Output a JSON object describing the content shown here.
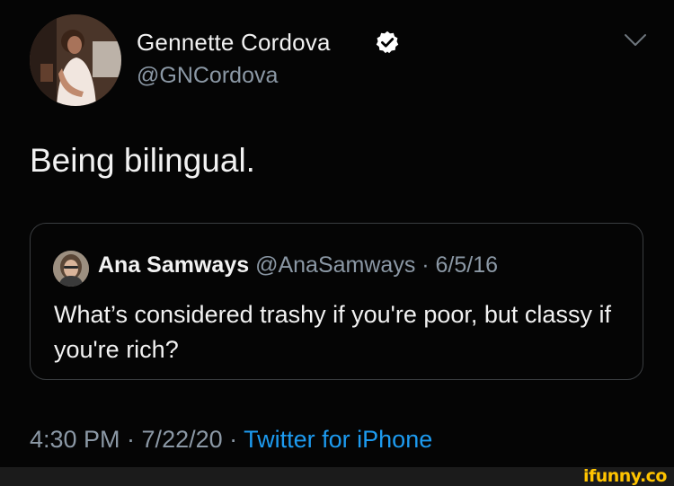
{
  "tweet": {
    "author": {
      "name": "Gennette Cordova",
      "handle": "@GNCordova",
      "verified": true
    },
    "text": "Being bilingual.",
    "quoted": {
      "name": "Ana Samways",
      "meta": "@AnaSamways · 6/5/16",
      "text": "What’s considered trashy if you're poor, but classy if you're rich?"
    },
    "footer": {
      "time_date": "4:30 PM · 7/22/20 · ",
      "source": "Twitter for iPhone"
    }
  },
  "watermark": {
    "text": "ifunny.co"
  },
  "colors": {
    "background": "#000000",
    "text_primary": "#f2f2f2",
    "text_secondary": "#8b98a5",
    "link": "#1d9bf0",
    "verified": "#ffffff",
    "watermark": "#ffc400"
  },
  "icons": {
    "verified": "verified-badge-icon",
    "menu": "chevron-down-icon"
  }
}
